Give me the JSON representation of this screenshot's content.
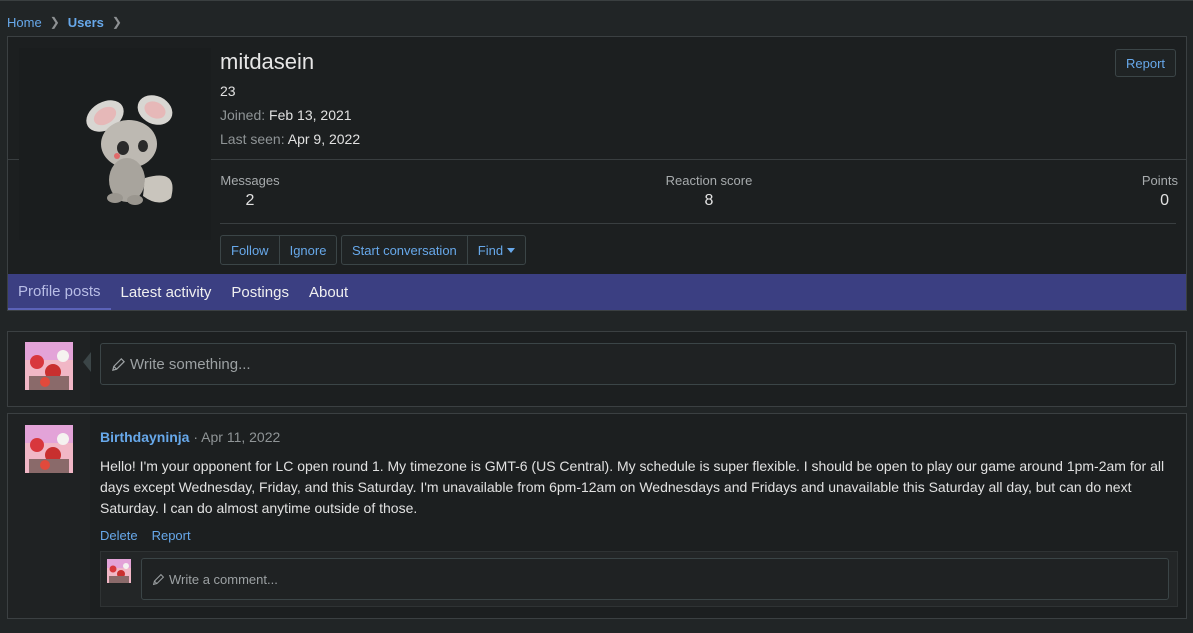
{
  "breadcrumb": {
    "home": "Home",
    "users": "Users"
  },
  "profile": {
    "username": "mitdasein",
    "title": "23",
    "joined_label": "Joined:",
    "joined_value": "Feb 13, 2021",
    "lastseen_label": "Last seen:",
    "lastseen_value": "Apr 9, 2022",
    "report_label": "Report",
    "stats": {
      "messages_label": "Messages",
      "messages_value": "2",
      "reaction_label": "Reaction score",
      "reaction_value": "8",
      "points_label": "Points",
      "points_value": "0"
    },
    "buttons": {
      "follow": "Follow",
      "ignore": "Ignore",
      "start_conversation": "Start conversation",
      "find": "Find"
    }
  },
  "tabs": [
    {
      "label": "Profile posts",
      "active": true
    },
    {
      "label": "Latest activity",
      "active": false
    },
    {
      "label": "Postings",
      "active": false
    },
    {
      "label": "About",
      "active": false
    }
  ],
  "composer": {
    "placeholder": "Write something..."
  },
  "post": {
    "author": "Birthdayninja",
    "separator": "·",
    "date": "Apr 11, 2022",
    "message": "Hello! I'm your opponent for LC open round 1. My timezone is GMT-6 (US Central). My schedule is super flexible. I should be open to play our game around 1pm-2am for all days except Wednesday, Friday, and this Saturday. I'm unavailable from 6pm-12am on Wednesdays and Fridays and unavailable this Saturday all day, but can do next Saturday. I can do almost anytime outside of those.",
    "delete_label": "Delete",
    "report_label": "Report",
    "comment_placeholder": "Write a comment..."
  },
  "colors": {
    "link": "#67a8ea",
    "tabbar": "#3b3f82",
    "background": "#212526",
    "panel": "#1c1f20"
  },
  "icons": {
    "pencil": "pencil-icon",
    "caret": "caret-down-icon",
    "chevron": "chevron-right-icon"
  }
}
